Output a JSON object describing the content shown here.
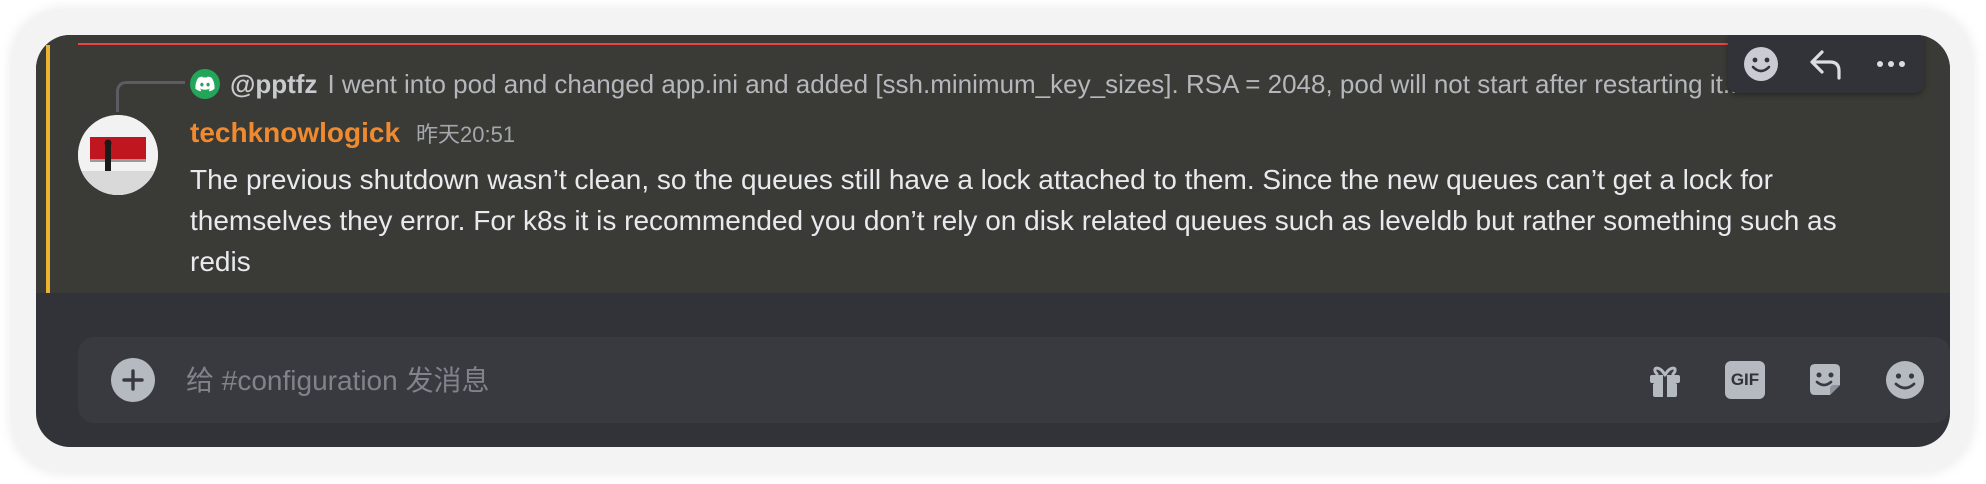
{
  "reply": {
    "author": "@pptfz",
    "text": "I went into pod and changed app.ini and added [ssh.minimum_key_sizes]. RSA = 2048, pod will not start after restarting it..."
  },
  "message": {
    "username": "techknowlogick",
    "timestamp": "昨天20:51",
    "text": "The previous shutdown wasn’t clean, so the queues still have a lock attached to them. Since the new queues can’t get a lock for themselves they error. For k8s it is recommended you don’t rely on disk related queues such as leveldb but rather something such as redis"
  },
  "toolbar": {
    "icons": [
      "add-reaction-icon",
      "reply-icon",
      "more-icon"
    ]
  },
  "composer": {
    "placeholder": "给 #configuration 发消息",
    "value": "",
    "gif_label": "GIF"
  },
  "colors": {
    "accent_username": "#f08a2e",
    "mention_bar": "#f0b232",
    "discord_green": "#23a55a",
    "new_messages_line": "#f23f43"
  }
}
